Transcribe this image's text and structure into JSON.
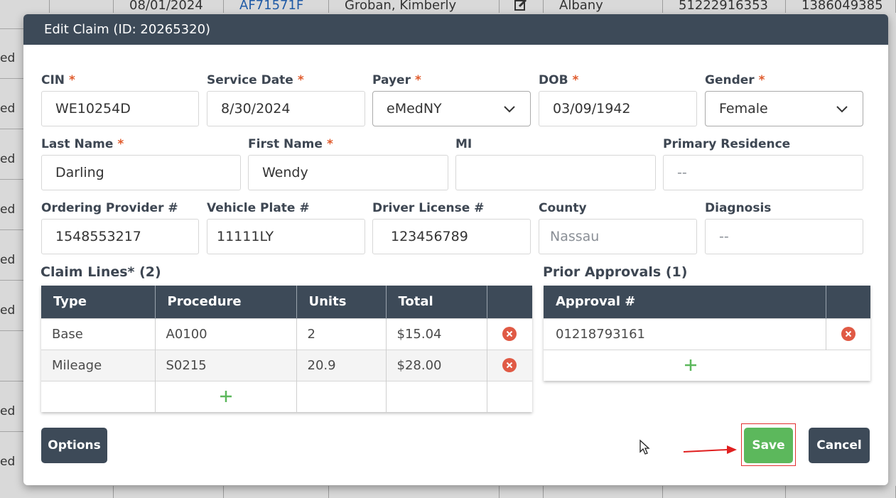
{
  "background_table": {
    "top_row": [
      "08/01/2024",
      "AF71571F",
      "Groban, Kimberly",
      "Albany",
      "51222916353",
      "1386049385"
    ],
    "status_fragments": [
      "ed",
      "ed",
      "ed",
      "ed",
      "ed",
      "ed",
      "ed",
      "ed"
    ]
  },
  "modal": {
    "title": "Edit Claim (ID: 20265320)",
    "required_mark": "*",
    "fields": {
      "cin": {
        "label": "CIN",
        "value": "WE10254D"
      },
      "service_date": {
        "label": "Service Date",
        "value": "8/30/2024"
      },
      "payer": {
        "label": "Payer",
        "value": "eMedNY"
      },
      "dob": {
        "label": "DOB",
        "value": "03/09/1942"
      },
      "gender": {
        "label": "Gender",
        "value": "Female"
      },
      "last_name": {
        "label": "Last Name",
        "value": "Darling"
      },
      "first_name": {
        "label": "First Name",
        "value": "Wendy"
      },
      "mi": {
        "label": "MI",
        "value": ""
      },
      "primary_residence": {
        "label": "Primary Residence",
        "value": "--"
      },
      "ordering_provider": {
        "label": "Ordering Provider #",
        "value": "1548553217"
      },
      "vehicle_plate": {
        "label": "Vehicle Plate #",
        "value": "11111LY"
      },
      "driver_license": {
        "label": "Driver License #",
        "value": "123456789"
      },
      "county": {
        "label": "County",
        "value": "Nassau"
      },
      "diagnosis": {
        "label": "Diagnosis",
        "value": "--"
      }
    },
    "claim_lines": {
      "title": "Claim Lines* (2)",
      "headers": [
        "Type",
        "Procedure",
        "Units",
        "Total"
      ],
      "rows": [
        [
          "Base",
          "A0100",
          "2",
          "$15.04"
        ],
        [
          "Mileage",
          "S0215",
          "20.9",
          "$28.00"
        ]
      ]
    },
    "prior_approvals": {
      "title": "Prior Approvals (1)",
      "headers": [
        "Approval #"
      ],
      "rows": [
        [
          "01218793161"
        ]
      ]
    },
    "buttons": {
      "options": "Options",
      "save": "Save",
      "cancel": "Cancel"
    }
  },
  "colors": {
    "header": "#3d4a58",
    "save": "#5cb85c",
    "delete": "#e05a45",
    "add": "#5cb85c",
    "highlight": "#e23030"
  }
}
